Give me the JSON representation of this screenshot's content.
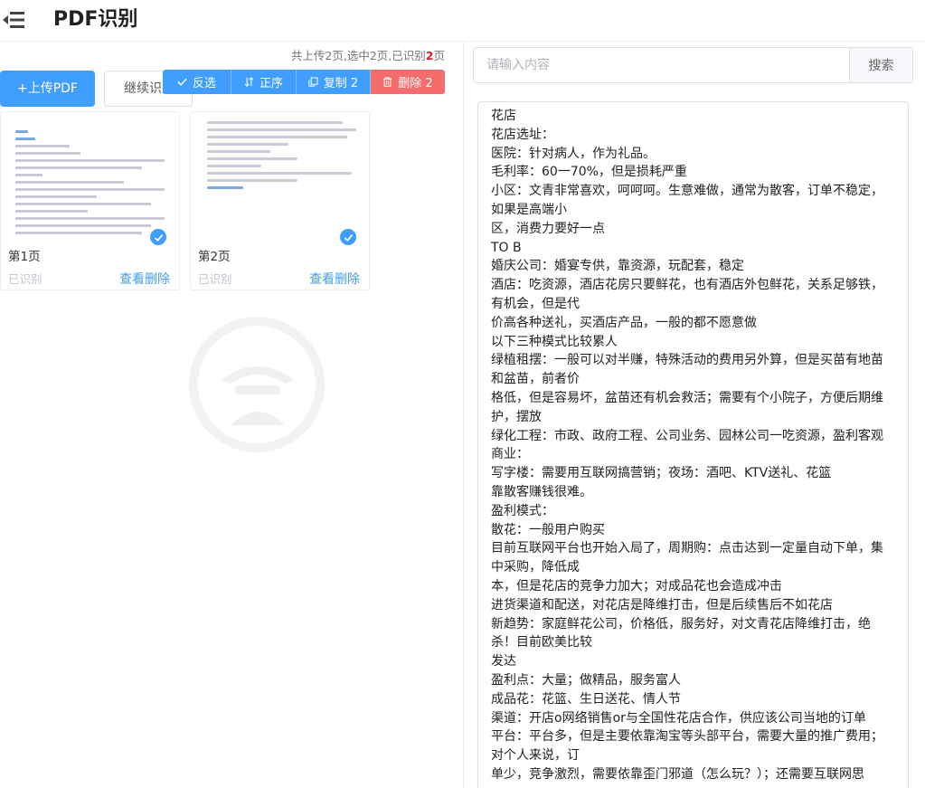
{
  "header": {
    "title": "PDF识别",
    "menu_icon": "menu-collapse-icon"
  },
  "stats": {
    "prefix": "共上传2页,选中2页,已识别",
    "recognized": "2",
    "suffix": "页"
  },
  "actions": {
    "upload_label": "+上传PDF",
    "continue_label": "继续识别"
  },
  "toolbar": {
    "invert_label": "反选",
    "order_label": "正序",
    "copy_label": "复制 2",
    "delete_label": "删除 2"
  },
  "pages": [
    {
      "name": "第1页",
      "status": "已识别",
      "view_label": "查看",
      "delete_label": "删除"
    },
    {
      "name": "第2页",
      "status": "已识别",
      "view_label": "查看",
      "delete_label": "删除"
    }
  ],
  "search": {
    "placeholder": "请输入内容",
    "button_label": "搜索"
  },
  "colors": {
    "primary": "#409eff",
    "danger": "#f56c6c",
    "stat_highlight": "#e02020"
  },
  "result_lines": [
    "花店",
    "花店选址：",
    "医院：针对病人，作为礼品。",
    "毛利率：60一70%，但是损耗严重",
    "小区：文青非常喜欢，呵呵呵。生意难做，通常为散客，订单不稳定，",
    "如果是高端小",
    "区，消费力要好一点",
    "TO B",
    "婚庆公司：婚宴专供，靠资源，玩配套，稳定",
    "酒店：吃资源，酒店花房只要鲜花，也有酒店外包鲜花，关系足够铁，",
    "有机会，但是代",
    "价高各种送礼，买酒店产品，一般的都不愿意做",
    "以下三种模式比较累人",
    "绿植租摆：一般可以对半赚，特殊活动的费用另外算，但是买苗有地苗",
    "和盆苗，前者价",
    "格低，但是容易坏，盆苗还有机会救活；需要有个小院子，方便后期维",
    "护，摆放",
    "绿化工程：市政、政府工程、公司业务、园林公司一吃资源，盈利客观",
    "商业：",
    "写字楼：需要用互联网搞营销；夜场：酒吧、KTV送礼、花篮",
    "靠散客赚钱很难。",
    "盈利模式：",
    "散花：一般用户购买",
    "目前互联网平台也开始入局了，周期购：点击达到一定量自动下单，集",
    "中采购，降低成",
    "本，但是花店的竞争力加大；对成品花也会造成冲击",
    "进货渠道和配送，对花店是降维打击，但是后续售后不如花店",
    "新趋势：家庭鲜花公司，价格低，服务好，对文青花店降维打击，绝",
    "杀！目前欧美比较",
    "发达",
    "盈利点：大量；做精品，服务富人",
    "成品花：花篮、生日送花、情人节",
    "渠道：开店o网络销售or与全国性花店合作，供应该公司当地的订单",
    "平台：平台多，但是主要依靠淘宝等头部平台，需要大量的推广费用；",
    "对个人来说，订",
    "单少，竞争激烈，需要依靠歪门邪道（怎么玩？）；还需要互联网思"
  ]
}
